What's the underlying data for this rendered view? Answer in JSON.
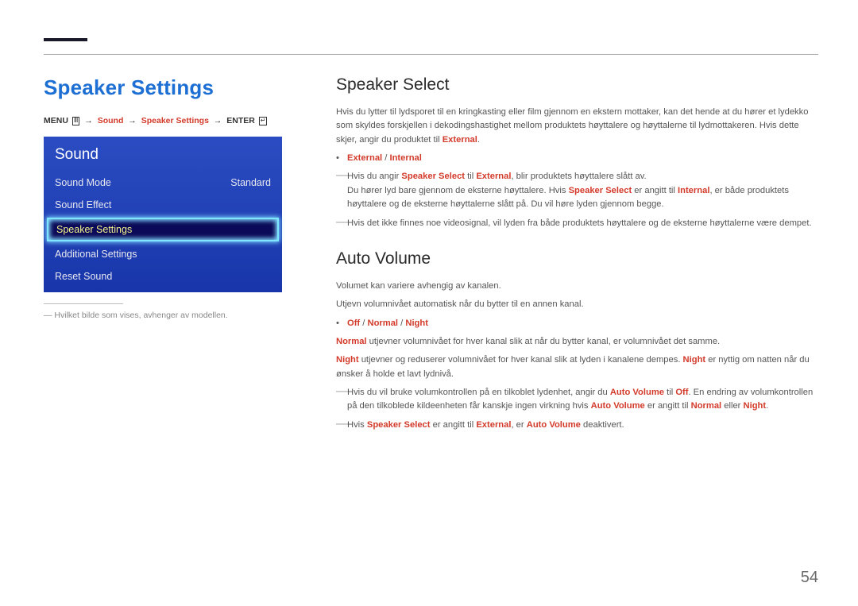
{
  "page_title": "Speaker Settings",
  "breadcrumb": {
    "menu": "MENU",
    "sound": "Sound",
    "speaker_settings": "Speaker Settings",
    "enter": "ENTER"
  },
  "osd": {
    "title": "Sound",
    "items": [
      {
        "label": "Sound Mode",
        "value": "Standard",
        "selected": false
      },
      {
        "label": "Sound Effect",
        "value": "",
        "selected": false
      },
      {
        "label": "Speaker Settings",
        "value": "",
        "selected": true
      },
      {
        "label": "Additional Settings",
        "value": "",
        "selected": false
      },
      {
        "label": "Reset Sound",
        "value": "",
        "selected": false
      }
    ]
  },
  "note_left": "Hvilket bilde som vises, avhenger av modellen.",
  "speaker_select": {
    "title": "Speaker Select",
    "intro_a": "Hvis du lytter til lydsporet til en kringkasting eller film gjennom en ekstern mottaker, kan det hende at du hører et lydekko som skyldes forskjellen i dekodingshastighet mellom produktets høyttalere og høyttalerne til lydmottakeren. Hvis dette skjer, angir du produktet til ",
    "intro_hl": "External",
    "intro_b": ".",
    "options": {
      "external": "External",
      "sep": " / ",
      "internal": "Internal"
    },
    "dash1_a": "Hvis du angir ",
    "dash1_hl1": "Speaker Select",
    "dash1_b": " til ",
    "dash1_hl2": "External",
    "dash1_c": ", blir produktets høyttalere slått av.",
    "dash1_line2_a": "Du hører lyd bare gjennom de eksterne høyttalere. Hvis ",
    "dash1_line2_hl1": "Speaker Select",
    "dash1_line2_b": " er angitt til ",
    "dash1_line2_hl2": "Internal",
    "dash1_line2_c": ", er både produktets høyttalere og de eksterne høyttalerne slått på. Du vil høre lyden gjennom begge.",
    "dash2": "Hvis det ikke finnes noe videosignal, vil lyden fra både produktets høyttalere og de eksterne høyttalerne være dempet."
  },
  "auto_volume": {
    "title": "Auto Volume",
    "p1": "Volumet kan variere avhengig av kanalen.",
    "p2": "Utjevn volumnivået automatisk når du bytter til en annen kanal.",
    "options": {
      "off": "Off",
      "sep1": " / ",
      "normal": "Normal",
      "sep2": " / ",
      "night": "Night"
    },
    "normal_a": "Normal",
    "normal_b": " utjevner volumnivået for hver kanal slik at når du bytter kanal, er volumnivået det samme.",
    "night_a": "Night",
    "night_b": " utjevner og reduserer volumnivået for hver kanal slik at lyden i kanalene dempes. ",
    "night_c": "Night",
    "night_d": " er nyttig om natten når du ønsker å holde et lavt lydnivå.",
    "dash1_a": "Hvis du vil bruke volumkontrollen på en tilkoblet lydenhet, angir du ",
    "dash1_hl1": "Auto Volume",
    "dash1_b": " til ",
    "dash1_hl2": "Off",
    "dash1_c": ". En endring av volumkontrollen på den tilkoblede kildeenheten får kanskje ingen virkning hvis ",
    "dash1_hl3": "Auto Volume",
    "dash1_d": " er angitt til ",
    "dash1_hl4": "Normal",
    "dash1_e": " eller ",
    "dash1_hl5": "Night",
    "dash1_f": ".",
    "dash2_a": "Hvis ",
    "dash2_hl1": "Speaker Select",
    "dash2_b": " er angitt til ",
    "dash2_hl2": "External",
    "dash2_c": ", er ",
    "dash2_hl3": "Auto Volume",
    "dash2_d": " deaktivert."
  },
  "page_number": "54"
}
